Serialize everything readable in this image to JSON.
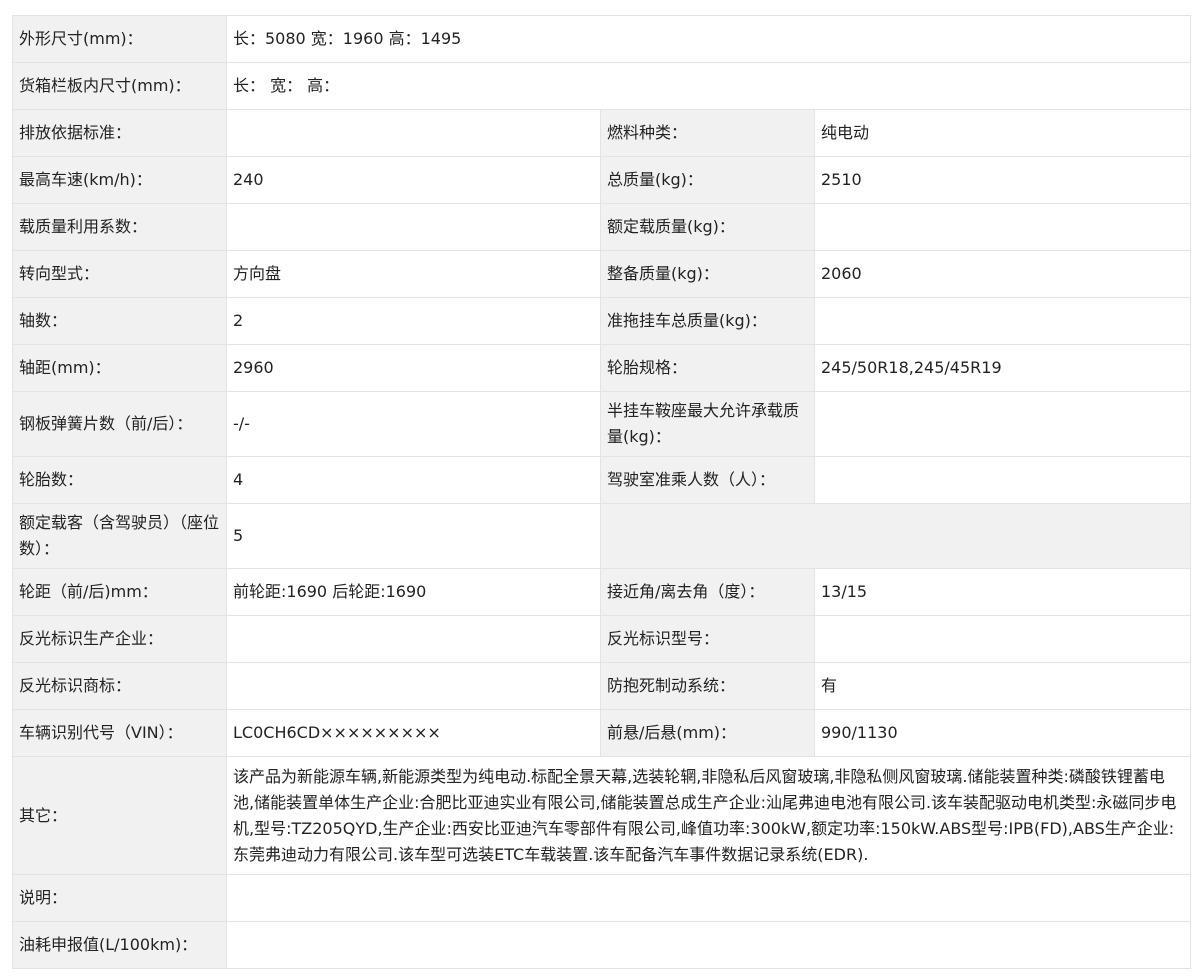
{
  "rows": {
    "outer_dim": {
      "label": "外形尺寸(mm)：",
      "value": "长：5080 宽：1960 高：1495"
    },
    "cargo_dim": {
      "label": "货箱栏板内尺寸(mm)：",
      "value": "长： 宽： 高："
    },
    "emission": {
      "label": "排放依据标准：",
      "value": ""
    },
    "fuel": {
      "label": "燃料种类：",
      "value": "纯电动"
    },
    "max_speed": {
      "label": "最高车速(km/h)：",
      "value": "240"
    },
    "total_mass": {
      "label": "总质量(kg)：",
      "value": "2510"
    },
    "load_coef": {
      "label": "载质量利用系数：",
      "value": ""
    },
    "rated_load": {
      "label": "额定载质量(kg)：",
      "value": ""
    },
    "steering": {
      "label": "转向型式：",
      "value": "方向盘"
    },
    "curb_mass": {
      "label": "整备质量(kg)：",
      "value": "2060"
    },
    "axles": {
      "label": "轴数：",
      "value": "2"
    },
    "trailer_mass": {
      "label": "准拖挂车总质量(kg)：",
      "value": ""
    },
    "wheelbase": {
      "label": "轴距(mm)：",
      "value": "2960"
    },
    "tire_spec": {
      "label": "轮胎规格：",
      "value": "245/50R18,245/45R19"
    },
    "leaf_spring": {
      "label": "钢板弹簧片数（前/后）：",
      "value": "-/-"
    },
    "saddle_mass": {
      "label": "半挂车鞍座最大允许承载质量(kg)：",
      "value": ""
    },
    "tires": {
      "label": "轮胎数：",
      "value": "4"
    },
    "cab_seats": {
      "label": "驾驶室准乘人数（人）：",
      "value": ""
    },
    "passengers": {
      "label": "额定载客（含驾驶员）（座位数）：",
      "value": "5"
    },
    "track": {
      "label": "轮距（前/后)mm：",
      "value": "前轮距:1690 后轮距:1690"
    },
    "angles": {
      "label": "接近角/离去角（度）：",
      "value": "13/15"
    },
    "reflector_maker": {
      "label": "反光标识生产企业：",
      "value": ""
    },
    "reflector_model": {
      "label": "反光标识型号：",
      "value": ""
    },
    "reflector_brand": {
      "label": "反光标识商标：",
      "value": ""
    },
    "abs": {
      "label": "防抱死制动系统：",
      "value": "有"
    },
    "vin": {
      "label": "车辆识别代号（VIN）：",
      "value": "LC0CH6CD×××××××××"
    },
    "overhang": {
      "label": "前悬/后悬(mm)：",
      "value": "990/1130"
    },
    "other": {
      "label": "其它：",
      "value": "该产品为新能源车辆,新能源类型为纯电动.标配全景天幕,选装轮辋,非隐私后风窗玻璃,非隐私侧风窗玻璃.储能装置种类:磷酸铁锂蓄电池,储能装置单体生产企业:合肥比亚迪实业有限公司,储能装置总成生产企业:汕尾弗迪电池有限公司.该车装配驱动电机类型:永磁同步电机,型号:TZ205QYD,生产企业:西安比亚迪汽车零部件有限公司,峰值功率:300kW,额定功率:150kW.ABS型号:IPB(FD),ABS生产企业:东莞弗迪动力有限公司.该车型可选装ETC车载装置.该车配备汽车事件数据记录系统(EDR)."
    },
    "note": {
      "label": "说明：",
      "value": ""
    },
    "fuel_consumption": {
      "label": "油耗申报值(L/100km)：",
      "value": ""
    }
  }
}
